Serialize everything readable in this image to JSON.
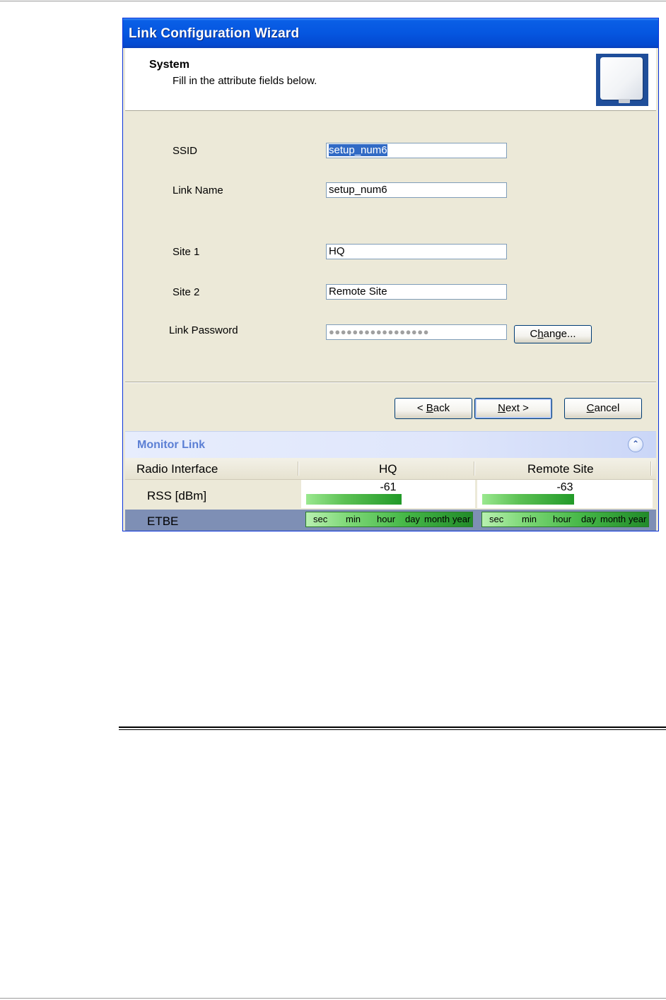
{
  "window": {
    "title": "Link Configuration Wizard",
    "header_title": "System",
    "header_subtitle": "Fill in the attribute fields below."
  },
  "form": {
    "ssid_label": "SSID",
    "ssid_value": "setup_num6",
    "link_name_label": "Link Name",
    "link_name_value": "setup_num6",
    "site1_label": "Site 1",
    "site1_value": "HQ",
    "site2_label": "Site 2",
    "site2_value": "Remote Site",
    "password_label": "Link Password",
    "password_value": "●●●●●●●●●●●●●●●●●",
    "change_button_pre": "C",
    "change_button_key": "h",
    "change_button_post": "ange..."
  },
  "buttons": {
    "back_pre": "< ",
    "back_key": "B",
    "back_post": "ack",
    "next_key": "N",
    "next_post": "ext >",
    "cancel_key": "C",
    "cancel_post": "ancel"
  },
  "monitor": {
    "title": "Monitor Link",
    "collapse_icon": "double-chevron-up-icon",
    "columns": [
      "Radio Interface",
      "HQ",
      "Remote Site"
    ],
    "rss_label": "RSS [dBm]",
    "rss_hq": "-61",
    "rss_remote": "-63",
    "rss_hq_level": 0.58,
    "rss_remote_level": 0.56,
    "etbe_label": "ETBE",
    "etbe_scale": [
      "sec",
      "min",
      "hour",
      "day",
      "month",
      "year"
    ]
  },
  "colors": {
    "title_bar": "#0556e0",
    "selection": "#316ac5",
    "monitor_title": "#5b7fd4",
    "rss_bar": "#229a28"
  }
}
